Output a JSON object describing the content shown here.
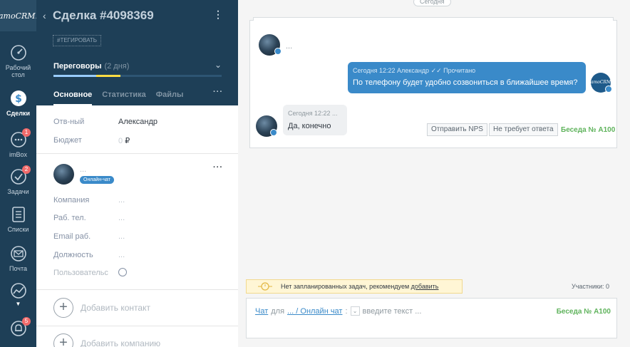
{
  "nav": {
    "logo": "amoCRM.",
    "items": [
      {
        "label": "Рабочий стол",
        "icon": "dashboard-icon",
        "badge": ""
      },
      {
        "label": "Сделки",
        "icon": "dollar-icon",
        "badge": ""
      },
      {
        "label": "imBox",
        "icon": "chat-bubble-icon",
        "badge": "1"
      },
      {
        "label": "Задачи",
        "icon": "check-circle-icon",
        "badge": "2"
      },
      {
        "label": "Списки",
        "icon": "list-icon",
        "badge": ""
      },
      {
        "label": "Почта",
        "icon": "envelope-icon",
        "badge": ""
      },
      {
        "label": "Аналитика",
        "icon": "analytics-icon",
        "badge": ""
      },
      {
        "label": "",
        "icon": "bell-icon",
        "badge": "5"
      }
    ]
  },
  "deal": {
    "title": "Сделка #4098369",
    "tag_button": "#ТЕГИРОВАТЬ",
    "stage": "Переговоры",
    "stage_duration": "(2 дня)",
    "tabs": [
      "Основное",
      "Статистика",
      "Файлы"
    ],
    "fields": [
      {
        "label": "Отв-ный",
        "value": "Александр"
      },
      {
        "label": "Бюджет",
        "value": "0",
        "currency": "₽"
      }
    ],
    "contact": {
      "name": "...",
      "chip": "Онлайн-чат",
      "fields": [
        {
          "label": "Компания",
          "value": "..."
        },
        {
          "label": "Раб. тел.",
          "value": "..."
        },
        {
          "label": "Email раб.",
          "value": "..."
        },
        {
          "label": "Должность",
          "value": "..."
        },
        {
          "label": "Пользовательс",
          "value": ""
        }
      ]
    },
    "add_contact": "Добавить контакт",
    "add_company": "Добавить компанию"
  },
  "feed": {
    "date_label": "Сегодня",
    "incoming_placeholder": "...",
    "outgoing": {
      "meta": "Сегодня 12:22 Александр",
      "status": "Прочитано",
      "text": "По телефону будет удобно созвониться в ближайшее время?"
    },
    "incoming": {
      "meta": "Сегодня 12:22 ...",
      "text": "Да, конечно"
    },
    "btn_nps": "Отправить NPS",
    "btn_no_reply": "Не требует ответа",
    "conversation": "Беседа № A100",
    "badge_logo": "amoCRM.",
    "task_notice": "Нет запланированных задач, рекомендуем",
    "task_link": "добавить",
    "participants": "Участники: 0",
    "composer": {
      "channel": "Чат",
      "for": "для",
      "recipient": "... / Онлайн чат",
      "colon": ":",
      "placeholder": "введите текст ...",
      "conversation": "Беседа № A100"
    }
  }
}
